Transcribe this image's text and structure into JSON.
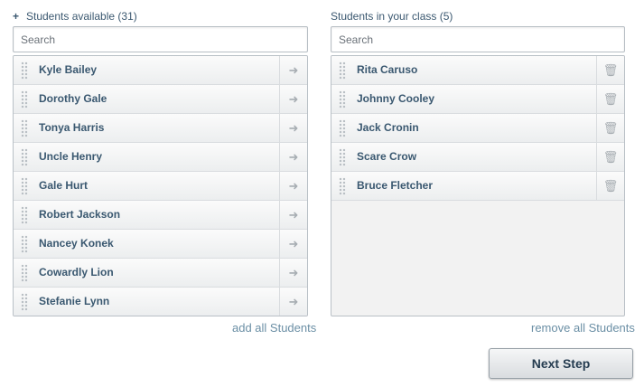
{
  "left_panel": {
    "plus": "+",
    "title": "Students available (31)",
    "search_placeholder": "Search",
    "items": [
      {
        "label": "Kyle Bailey"
      },
      {
        "label": "Dorothy Gale"
      },
      {
        "label": "Tonya Harris"
      },
      {
        "label": "Uncle Henry"
      },
      {
        "label": "Gale Hurt"
      },
      {
        "label": "Robert Jackson"
      },
      {
        "label": "Nancey Konek"
      },
      {
        "label": "Cowardly Lion"
      },
      {
        "label": "Stefanie Lynn"
      }
    ],
    "add_all": "add all Students",
    "action_icon": "arrow-right-icon"
  },
  "right_panel": {
    "title": "Students in your class (5)",
    "search_placeholder": "Search",
    "items": [
      {
        "label": "Rita Caruso"
      },
      {
        "label": "Johnny Cooley"
      },
      {
        "label": "Jack Cronin"
      },
      {
        "label": "Scare Crow"
      },
      {
        "label": "Bruce Fletcher"
      }
    ],
    "remove_all": "remove all Students",
    "action_icon": "trash-icon"
  },
  "next_step": "Next Step"
}
